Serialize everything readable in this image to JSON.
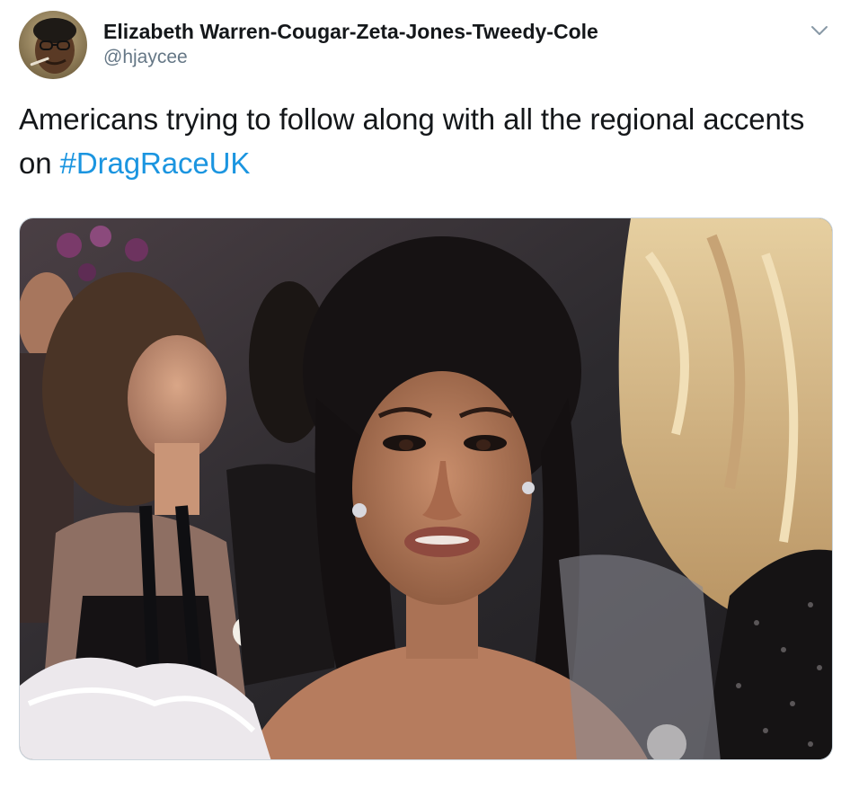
{
  "tweet": {
    "author": {
      "display_name": "Elizabeth Warren-Cougar-Zeta-Jones-Tweedy-Cole",
      "handle": "@hjaycee",
      "avatar": "profile-photo"
    },
    "menu_icon": "chevron-down-icon",
    "text_before": "Americans trying to follow along with all the regional accents on ",
    "hashtag": "#DragRaceUK",
    "media": {
      "type": "photo",
      "description_icon": "meme-photo"
    }
  },
  "colors": {
    "text": "#14171a",
    "secondary": "#657786",
    "link": "#1b95e0",
    "border": "#ccd6dd"
  }
}
